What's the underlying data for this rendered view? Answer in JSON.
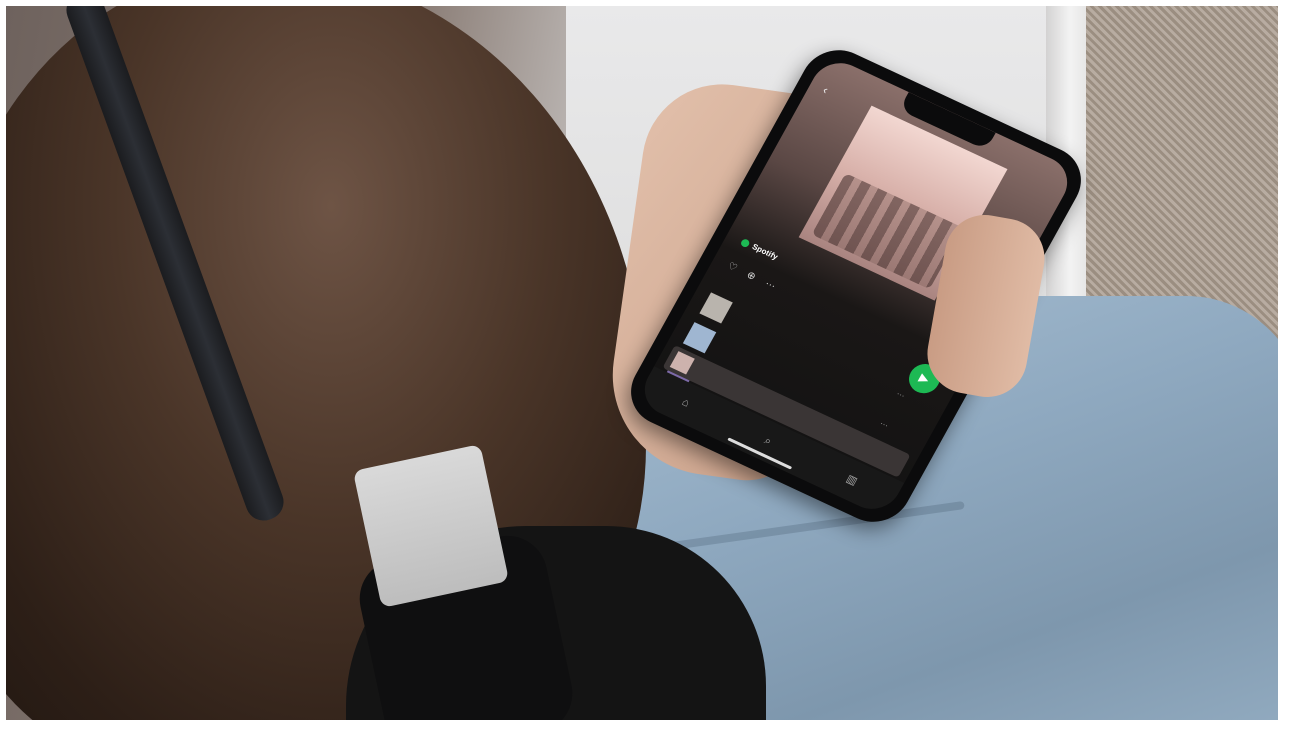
{
  "scene": {
    "description_free": true
  },
  "phone": {
    "status_time": "",
    "playlist_cover_title": "",
    "playlist": {
      "name": "",
      "owner": "Spotify",
      "meta": ""
    },
    "tracks": [
      {
        "title": "",
        "artist": "",
        "active": true,
        "thumb_color": "#b9b4ad"
      },
      {
        "title": "",
        "artist": "",
        "active": false,
        "thumb_color": "#9fb6d1"
      },
      {
        "title": "",
        "artist": "",
        "active": false,
        "thumb_color": "#7d6aa8"
      },
      {
        "title": "",
        "artist": "",
        "active": false,
        "thumb_color": "#d9d6d0"
      }
    ],
    "mini_player": {
      "title": "",
      "artist": ""
    },
    "tabs": [
      {
        "icon": "home-icon",
        "label": ""
      },
      {
        "icon": "search-icon",
        "label": ""
      },
      {
        "icon": "library-icon",
        "label": ""
      }
    ],
    "colors": {
      "accent": "#1db954",
      "background": "#121212"
    }
  }
}
